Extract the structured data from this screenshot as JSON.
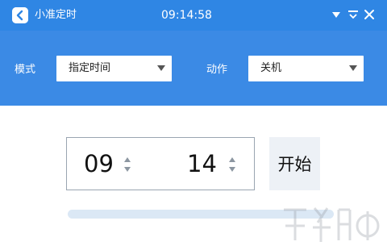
{
  "titlebar": {
    "app_title": "小准定时",
    "clock": "09:14:58",
    "icons": {
      "app": "back-arrow-icon",
      "minimize": "minimize-triangle-icon",
      "menu": "chevron-down-icon",
      "close": "close-icon"
    }
  },
  "settings": {
    "mode_label": "模式",
    "mode_value": "指定时间",
    "action_label": "动作",
    "action_value": "关机"
  },
  "timer": {
    "hour": "09",
    "minute": "14",
    "start_label": "开始",
    "progress": 0
  },
  "colors": {
    "titlebar": "#2f86e4",
    "settings_panel": "#3b8ae5",
    "start_button": "#edf1f6",
    "progress_track": "#dbe8f5"
  }
}
